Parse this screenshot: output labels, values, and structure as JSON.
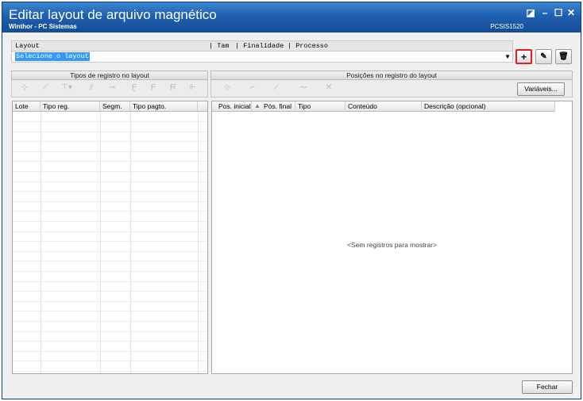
{
  "window": {
    "title": "Editar layout de arquivo magnético",
    "subtitle": "Winthor - PC Sistemas",
    "code": "PCSIS1520",
    "controls": [
      "◪",
      "–",
      "☐",
      "✕"
    ]
  },
  "layout": {
    "header_label": "Layout",
    "columns": [
      "| Tam",
      "| Finalidade",
      "| Processo"
    ],
    "selected_value": "Selecione o layout"
  },
  "actions": {
    "add": "+",
    "edit": "✎",
    "delete": "🗑"
  },
  "left_panel": {
    "title": "Tipos de registro no layout",
    "toolbar_icons": [
      "⊹",
      "⟋",
      "⊤▾",
      "⫽",
      "⊸",
      "F̥",
      "F",
      "F̸",
      "⊩"
    ],
    "columns": [
      "Lote",
      "Tipo reg.",
      "Segm.",
      "Tipo pagto."
    ]
  },
  "right_panel": {
    "title": "Posições no registro do layout",
    "toolbar_icons": [
      "⊹",
      "⌐",
      "⟋",
      "⁓",
      "✕"
    ],
    "variables_button": "Variáveis...",
    "columns": [
      "Pos. inicial",
      "Pós. final",
      "Tipo",
      "Conteúdo",
      "Descrição (opcional)"
    ],
    "sort_indicator": "▲",
    "empty_message": "<Sem registros para mostrar>"
  },
  "footer": {
    "close_button": "Fechar"
  }
}
